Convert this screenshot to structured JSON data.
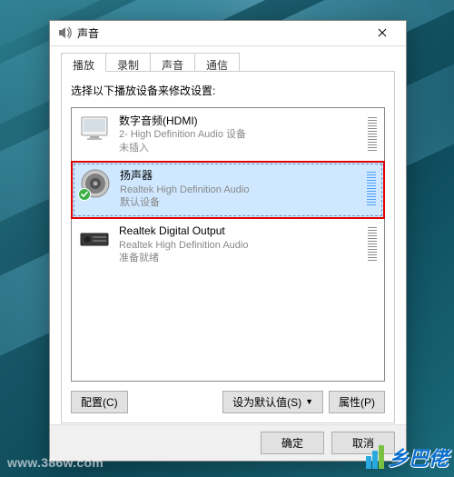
{
  "title": "声音",
  "tabs": {
    "playback": "播放",
    "recording": "录制",
    "sounds": "声音",
    "comm": "通信"
  },
  "instruction": "选择以下播放设备来修改设置:",
  "devices": [
    {
      "name": "数字音频(HDMI)",
      "desc": "2- High Definition Audio 设备",
      "status": "未插入"
    },
    {
      "name": "扬声器",
      "desc": "Realtek High Definition Audio",
      "status": "默认设备"
    },
    {
      "name": "Realtek Digital Output",
      "desc": "Realtek High Definition Audio",
      "status": "准备就绪"
    }
  ],
  "buttons": {
    "configure": "配置(C)",
    "set_default": "设为默认值(S)",
    "properties": "属性(P)",
    "ok": "确定",
    "cancel": "取消"
  },
  "watermark": {
    "text": "乡巴佬",
    "url": "www.386w.com"
  }
}
